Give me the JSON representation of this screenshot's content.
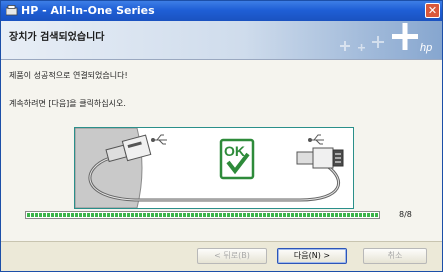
{
  "window": {
    "title": "HP - All-In-One Series",
    "close_glyph": "✕"
  },
  "banner": {
    "title": "장치가 검색되었습니다"
  },
  "content": {
    "message_connected": "제품이 성공적으로 연결되었습니다!",
    "message_continue": "계속하려면 [다음]을 클릭하십시오.",
    "illustration": {
      "ok_text": "OK",
      "icons": [
        "usb-plug-icon",
        "ok-check-icon",
        "usb-plug-icon"
      ]
    }
  },
  "progress": {
    "fraction": 1.0,
    "label": "8/8"
  },
  "buttons": {
    "back": "< 뒤로(B)",
    "next": "다음(N) >",
    "cancel": "취소"
  },
  "colors": {
    "titlebar": "#1f5fd6",
    "progress": "#3bb44a",
    "ok_green": "#2e8b3a",
    "illus_border": "#2a8f8a"
  }
}
